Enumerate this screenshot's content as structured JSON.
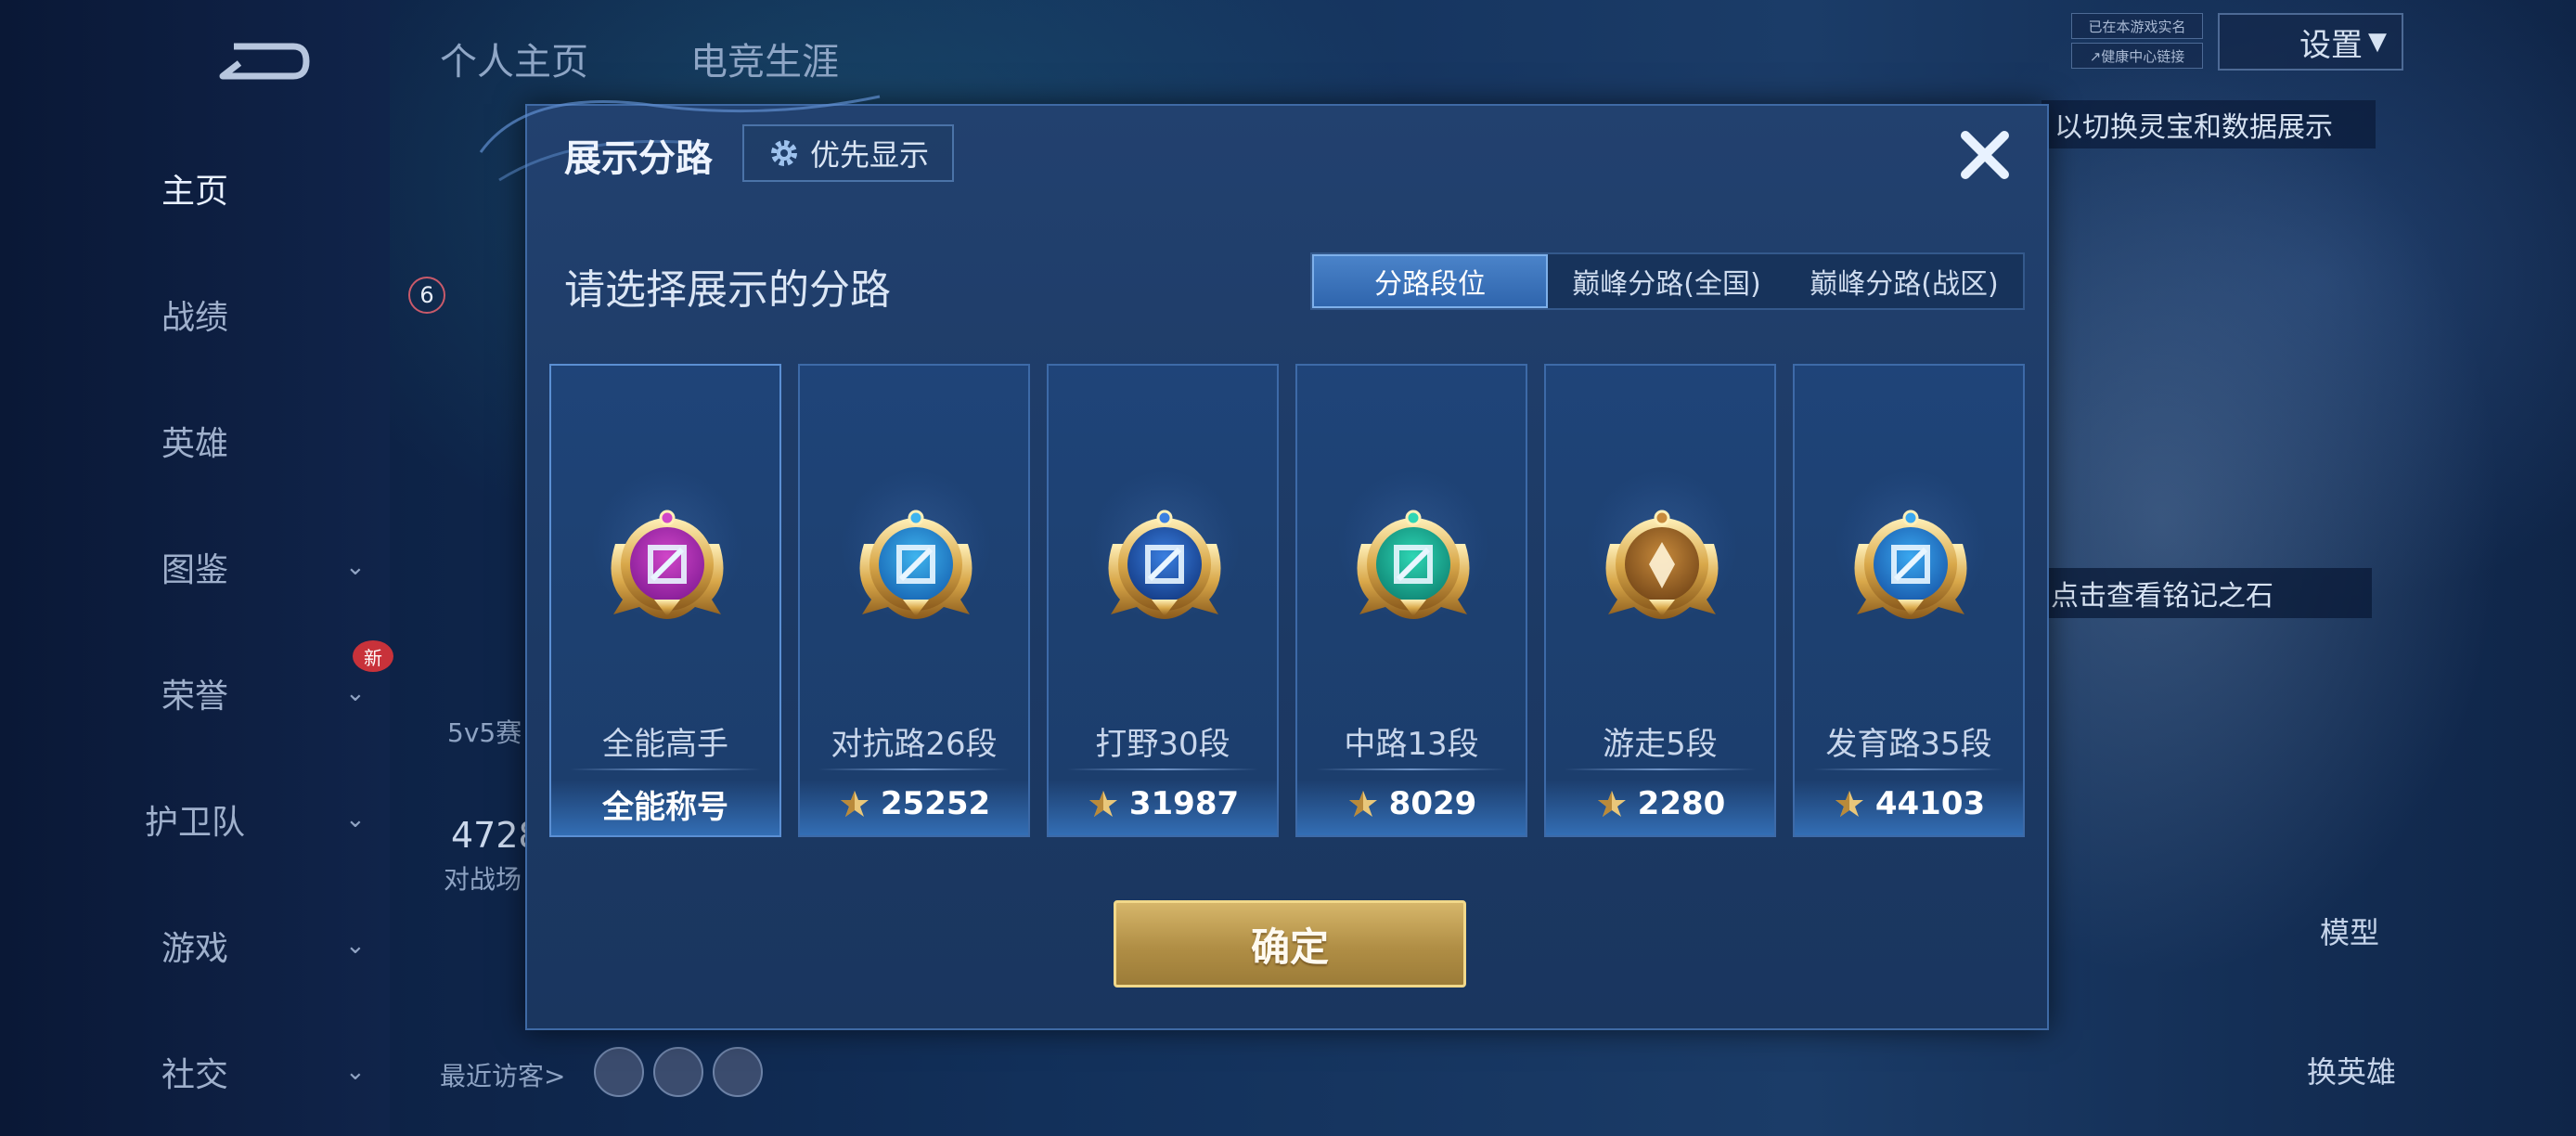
{
  "background": {
    "top_tabs": [
      "个人主页",
      "电竞生涯"
    ],
    "nav_items": [
      {
        "label": "主页",
        "active": true,
        "chevron": false
      },
      {
        "label": "战绩",
        "active": false,
        "chevron": false
      },
      {
        "label": "英雄",
        "active": false,
        "chevron": false
      },
      {
        "label": "图鉴",
        "active": false,
        "chevron": true
      },
      {
        "label": "荣誉",
        "active": false,
        "chevron": true
      },
      {
        "label": "护卫队",
        "active": false,
        "chevron": true
      },
      {
        "label": "游戏",
        "active": false,
        "chevron": true
      },
      {
        "label": "社交",
        "active": false,
        "chevron": true
      }
    ],
    "new_badge": "新",
    "settings_label": "设置",
    "small_box_1": "已在本游戏实名",
    "small_box_2": "↗健康中心链接",
    "right_hint": "以切换灵宝和数据展示",
    "right_hint2": "点击查看铭记之石",
    "model_label": "模型",
    "switch_hero_label": "换英雄",
    "recent_visitors": "最近访客>",
    "level_badge": "6",
    "battle_count": "4728",
    "battle_label": "对战场",
    "mode_label": "5v5赛"
  },
  "dialog": {
    "title": "展示分路",
    "priority_button": "优先显示",
    "subtitle": "请选择展示的分路",
    "segments": [
      {
        "label": "分路段位",
        "active": true
      },
      {
        "label": "巅峰分路(全国)",
        "active": false
      },
      {
        "label": "巅峰分路(战区)",
        "active": false
      }
    ],
    "cards": [
      {
        "name": "全能高手",
        "value": "全能称号",
        "has_icon": false,
        "emblem": "allround-emblem",
        "colors": [
          "#d046c8",
          "#8a1f9a"
        ]
      },
      {
        "name": "对抗路26段",
        "value": "25252",
        "has_icon": true,
        "emblem": "clash-lane-emblem",
        "colors": [
          "#3fb4ee",
          "#1a6bb8"
        ]
      },
      {
        "name": "打野30段",
        "value": "31987",
        "has_icon": true,
        "emblem": "jungle-emblem",
        "colors": [
          "#3a7fe0",
          "#163f8a"
        ]
      },
      {
        "name": "中路13段",
        "value": "8029",
        "has_icon": true,
        "emblem": "mid-lane-emblem",
        "colors": [
          "#2ed6b4",
          "#118a78"
        ]
      },
      {
        "name": "游走5段",
        "value": "2280",
        "has_icon": true,
        "emblem": "roam-emblem",
        "colors": [
          "#c78a3c",
          "#7a4b1a"
        ]
      },
      {
        "name": "发育路35段",
        "value": "44103",
        "has_icon": true,
        "emblem": "farm-lane-emblem",
        "colors": [
          "#3aa8f0",
          "#1b5fb0"
        ]
      }
    ],
    "confirm_button": "确定"
  }
}
